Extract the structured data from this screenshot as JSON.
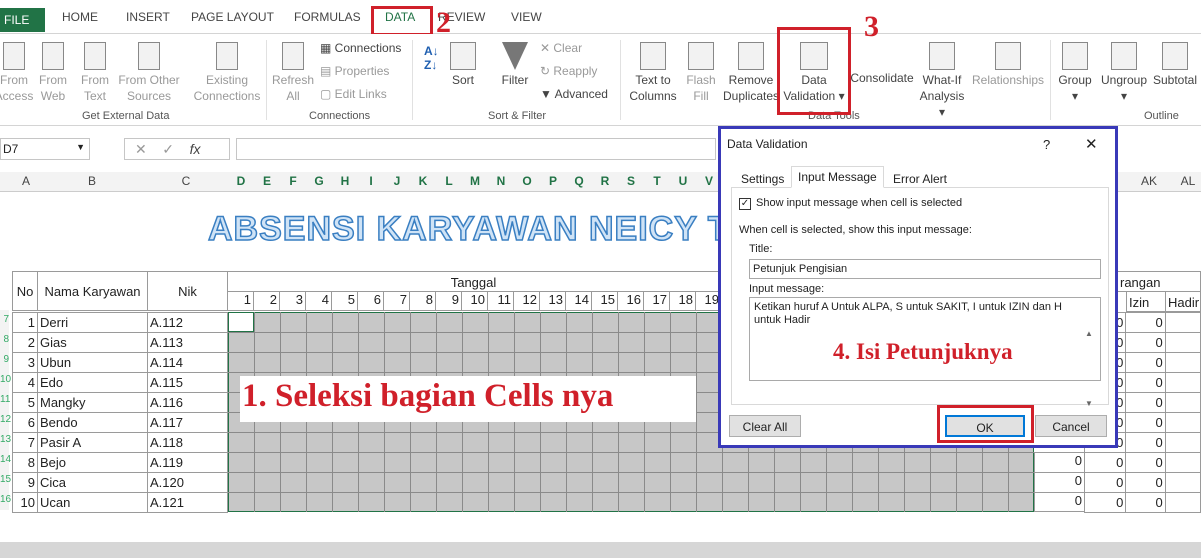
{
  "tabs": {
    "file": "FILE",
    "home": "HOME",
    "insert": "INSERT",
    "page_layout": "PAGE LAYOUT",
    "formulas": "FORMULAS",
    "data": "DATA",
    "review": "REVIEW",
    "view": "VIEW"
  },
  "ribbon": {
    "from_access_l1": "From",
    "from_access_l2": "Access",
    "from_web_l1": "From",
    "from_web_l2": "Web",
    "from_text_l1": "From",
    "from_text_l2": "Text",
    "from_other_l1": "From Other",
    "from_other_l2": "Sources",
    "existing_l1": "Existing",
    "existing_l2": "Connections",
    "refresh_l1": "Refresh",
    "refresh_l2": "All",
    "connections": "Connections",
    "properties": "Properties",
    "edit_links": "Edit Links",
    "sort": "Sort",
    "filter": "Filter",
    "clear": "Clear",
    "reapply": "Reapply",
    "advanced": "Advanced",
    "text_to_l1": "Text to",
    "text_to_l2": "Columns",
    "flash_l1": "Flash",
    "flash_l2": "Fill",
    "remove_l1": "Remove",
    "remove_l2": "Duplicates",
    "dv_l1": "Data",
    "dv_l2": "Validation",
    "consolidate": "Consolidate",
    "whatif_l1": "What-If",
    "whatif_l2": "Analysis",
    "relationships": "Relationships",
    "group": "Group",
    "ungroup": "Ungroup",
    "subtotal": "Subtotal",
    "grp_external": "Get External Data",
    "grp_connections": "Connections",
    "grp_sortfilter": "Sort & Filter",
    "grp_datatools": "Data Tools",
    "grp_outline": "Outline"
  },
  "formula_bar": {
    "name_box": "D7",
    "fx": "fx"
  },
  "columns": [
    "A",
    "B",
    "C",
    "D",
    "E",
    "F",
    "G",
    "H",
    "I",
    "J",
    "K",
    "L",
    "M",
    "N",
    "O",
    "P",
    "Q",
    "R",
    "S",
    "T",
    "U",
    "V",
    "AK",
    "AL"
  ],
  "sheet": {
    "title": "ABSENSI KARYAWAN NEICY T",
    "hdr_no": "No",
    "hdr_nama": "Nama Karyawan",
    "hdr_nik": "Nik",
    "hdr_tanggal": "Tanggal",
    "hdr_keterangan": "rangan",
    "hdr_izin": "Izin",
    "hdr_hadir": "Hadir",
    "days": [
      "1",
      "2",
      "3",
      "4",
      "5",
      "6",
      "7",
      "8",
      "9",
      "10",
      "11",
      "12",
      "13",
      "14",
      "15",
      "16",
      "17",
      "18",
      "19"
    ],
    "rows": [
      {
        "no": "1",
        "nama": "Derri",
        "nik": "A.112",
        "a": "0",
        "b": "0"
      },
      {
        "no": "2",
        "nama": "Gias",
        "nik": "A.113",
        "a": "0",
        "b": "0"
      },
      {
        "no": "3",
        "nama": "Ubun",
        "nik": "A.114",
        "a": "0",
        "b": "0"
      },
      {
        "no": "4",
        "nama": "Edo",
        "nik": "A.115",
        "a": "0",
        "b": "0"
      },
      {
        "no": "5",
        "nama": "Mangky",
        "nik": "A.116",
        "a": "0",
        "b": "0"
      },
      {
        "no": "6",
        "nama": "Bendo",
        "nik": "A.117",
        "a": "0",
        "b": "0"
      },
      {
        "no": "7",
        "nama": "Pasir A",
        "nik": "A.118",
        "a": "0",
        "b": "0"
      },
      {
        "no": "8",
        "nama": "Bejo",
        "nik": "A.119",
        "a": "0",
        "b": "0"
      },
      {
        "no": "9",
        "nama": "Cica",
        "nik": "A.120",
        "a": "0",
        "b": "0"
      },
      {
        "no": "10",
        "nama": "Ucan",
        "nik": "A.121",
        "a": "0",
        "b": "0"
      }
    ],
    "extra_zero": "0"
  },
  "dialog": {
    "title": "Data Validation",
    "help": "?",
    "close": "✕",
    "tab_settings": "Settings",
    "tab_input": "Input Message",
    "tab_error": "Error Alert",
    "show_msg": "Show input message when cell is selected",
    "when_selected": "When cell is selected, show this input message:",
    "title_label": "Title:",
    "title_value": "Petunjuk Pengisian",
    "msg_label": "Input message:",
    "msg_value": "Ketikan huruf A Untuk ALPA, S untuk SAKIT, I untuk IZIN dan H untuk Hadir",
    "clear_all": "Clear All",
    "ok": "OK",
    "cancel": "Cancel"
  },
  "annotations": {
    "n2": "2",
    "n3": "3",
    "step1": "1. Seleksi bagian Cells nya",
    "step4": "4. Isi Petunjuknya"
  },
  "colors": {
    "accent": "#217346",
    "annot_red": "#d0202a",
    "dialog_border": "#3939b8"
  }
}
